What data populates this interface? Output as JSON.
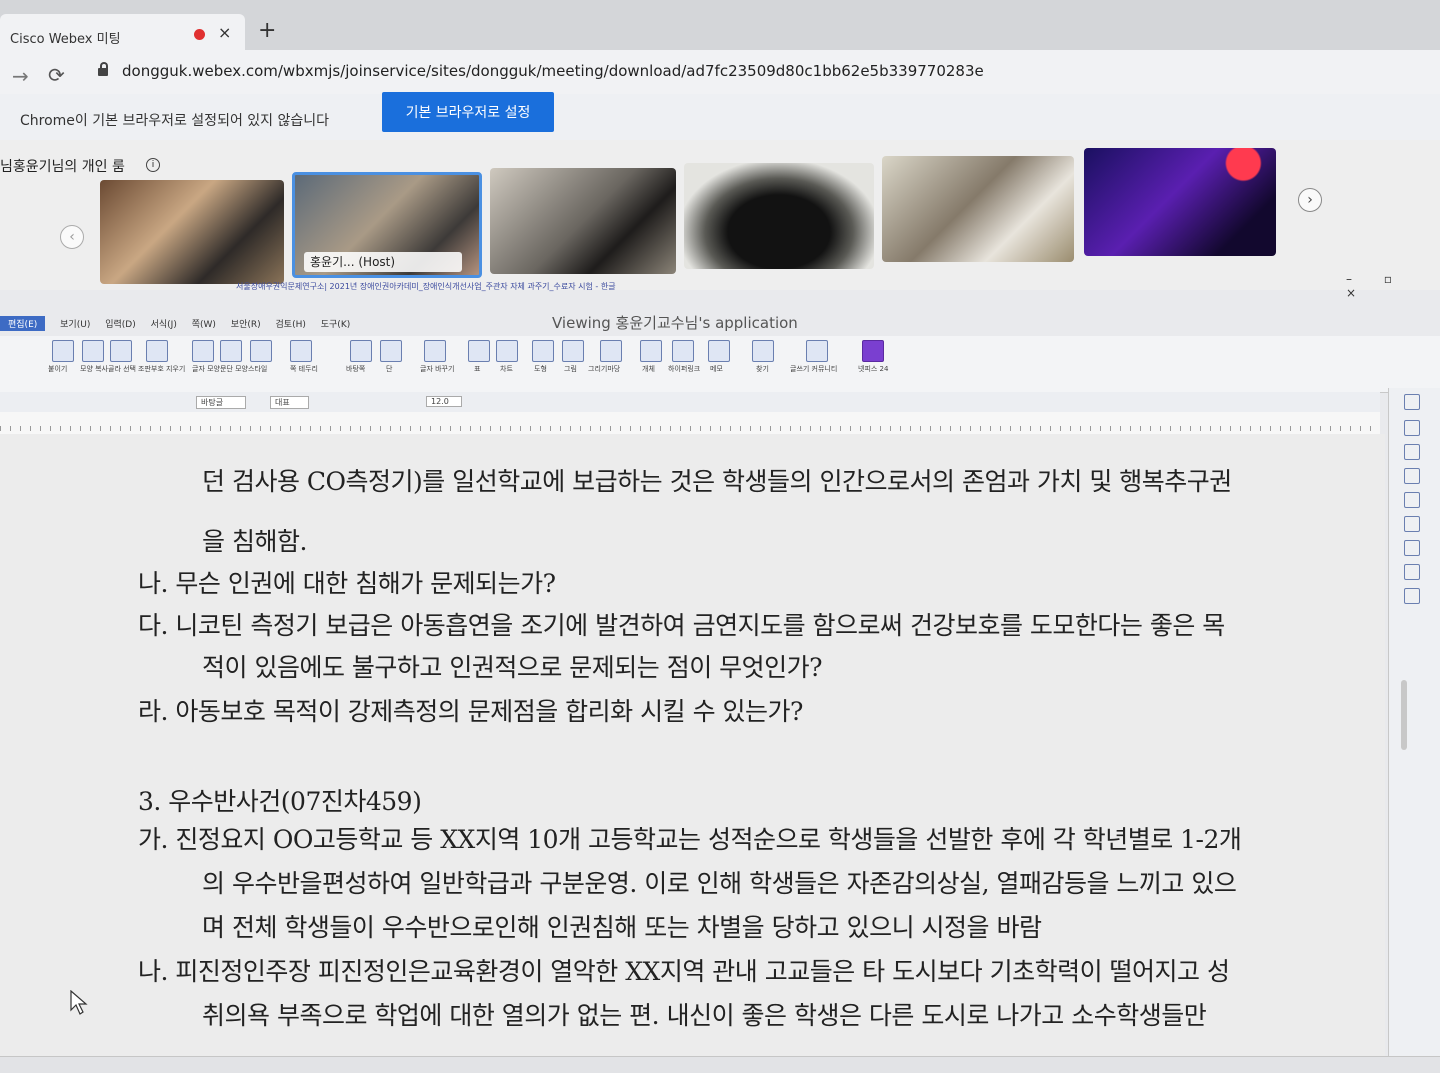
{
  "browser": {
    "tab_title": "Cisco Webex 미팅",
    "close_glyph": "×",
    "new_tab_glyph": "+",
    "url": "dongguk.webex.com/wbxmjs/joinservice/sites/dongguk/meeting/download/ad7fc23509d80c1bb62e5b339770283e",
    "info_text": "Chrome이 기본 브라우저로 설정되어 있지 않습니다",
    "set_default_label": "기본 브라우저로 설정"
  },
  "webex": {
    "room_title": "님홍윤기님의 개인 룸",
    "info_glyph": "i",
    "host_label": "홍윤기... (Host)",
    "prev_glyph": "‹",
    "next_glyph": "›"
  },
  "hwp": {
    "title": "서울장애우권익문제연구소| 2021년 장애인권아카데미_장애인식개선사업_주관자 자체 과주기_수료자 시험 - 한글",
    "viewing_text": "Viewing 홍윤기교수님's application",
    "menu": [
      "편집(E)",
      "보기(U)",
      "입력(D)",
      "서식(J)",
      "쪽(W)",
      "보안(R)",
      "검토(H)",
      "도구(K)"
    ],
    "ribbon_labels": [
      "붙이기",
      "모양 복사",
      "골라 선택",
      "조판부호 지우기",
      "글자 모양",
      "문단 모양",
      "스타일",
      "쪽 테두리",
      "바탕쪽",
      "단",
      "글자 바꾸기",
      "표",
      "차트",
      "도형",
      "그림",
      "그리기마당",
      "개체",
      "하이퍼링크",
      "메모",
      "찾기",
      "글쓰기 커뮤니티",
      "넷피스 24"
    ],
    "fmt_style": "바탕글",
    "fmt_font": "대표",
    "fmt_size": "12.0"
  },
  "document": {
    "lines": [
      "던 검사용 CO측정기)를 일선학교에 보급하는 것은 학생들의 인간으로서의 존엄과 가치 및 행복추구권",
      "을 침해함.",
      "나. 무슨 인권에 대한 침해가 문제되는가?",
      "다. 니코틴 측정기 보급은 아동흡연을 조기에 발견하여 금연지도를 함으로써 건강보호를 도모한다는 좋은 목",
      "적이 있음에도 불구하고 인권적으로 문제되는 점이 무엇인가?",
      "라. 아동보호 목적이 강제측정의 문제점을 합리화 시킬 수 있는가?",
      "3. 우수반사건(07진차459)",
      "가. 진정요지 OO고등학교 등 XX지역 10개 고등학교는 성적순으로 학생들을 선발한 후에 각 학년별로 1-2개",
      "의 우수반을편성하여 일반학급과 구분운영. 이로 인해 학생들은 자존감의상실, 열패감등을 느끼고 있으",
      "며 전체 학생들이 우수반으로인해 인권침해 또는 차별을 당하고 있으니 시정을 바람",
      "나. 피진정인주장 피진정인은교육환경이 열악한 XX지역 관내 고교들은 타 도시보다 기초학력이 떨어지고 성",
      "취의욕 부족으로 학업에 대한 열의가 없는 편. 내신이 좋은 학생은 다른 도시로 나가고 소수학생들만"
    ]
  }
}
